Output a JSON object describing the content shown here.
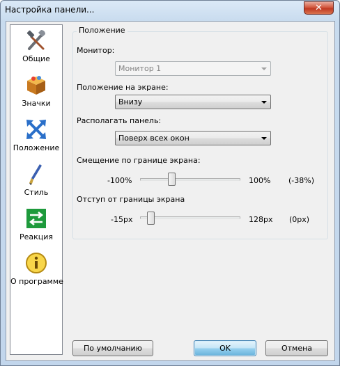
{
  "window": {
    "title": "Настройка панели..."
  },
  "sidebar": {
    "items": [
      {
        "label": "Общие",
        "icon": "tools-icon"
      },
      {
        "label": "Значки",
        "icon": "box-icon"
      },
      {
        "label": "Положение",
        "icon": "move-arrows-icon"
      },
      {
        "label": "Стиль",
        "icon": "brush-icon"
      },
      {
        "label": "Реакция",
        "icon": "exchange-arrows-icon"
      },
      {
        "label": "О программе",
        "icon": "info-icon"
      }
    ],
    "selected": "Положение"
  },
  "position_group": {
    "title": "Положение",
    "monitor": {
      "label": "Монитор:",
      "value": "Монитор 1",
      "enabled": false
    },
    "screen_position": {
      "label": "Положение на экране:",
      "value": "Внизу"
    },
    "panel_placement": {
      "label": "Располагать панель:",
      "value": "Поверх всех окон"
    },
    "offset": {
      "label": "Смещение по границе экрана:",
      "min_label": "-100%",
      "max_label": "100%",
      "current_label": "(-38%)",
      "min": -100,
      "max": 100,
      "value": -38
    },
    "margin": {
      "label": "Отступ от границы экрана",
      "min_label": "-15px",
      "max_label": "128px",
      "current_label": "(0px)",
      "min": -15,
      "max": 128,
      "value": 0
    }
  },
  "buttons": {
    "defaults": "По умолчанию",
    "ok": "OK",
    "cancel": "Отмена"
  },
  "colors": {
    "accent": "#3c7fb1",
    "selection": "#cce8ff"
  }
}
